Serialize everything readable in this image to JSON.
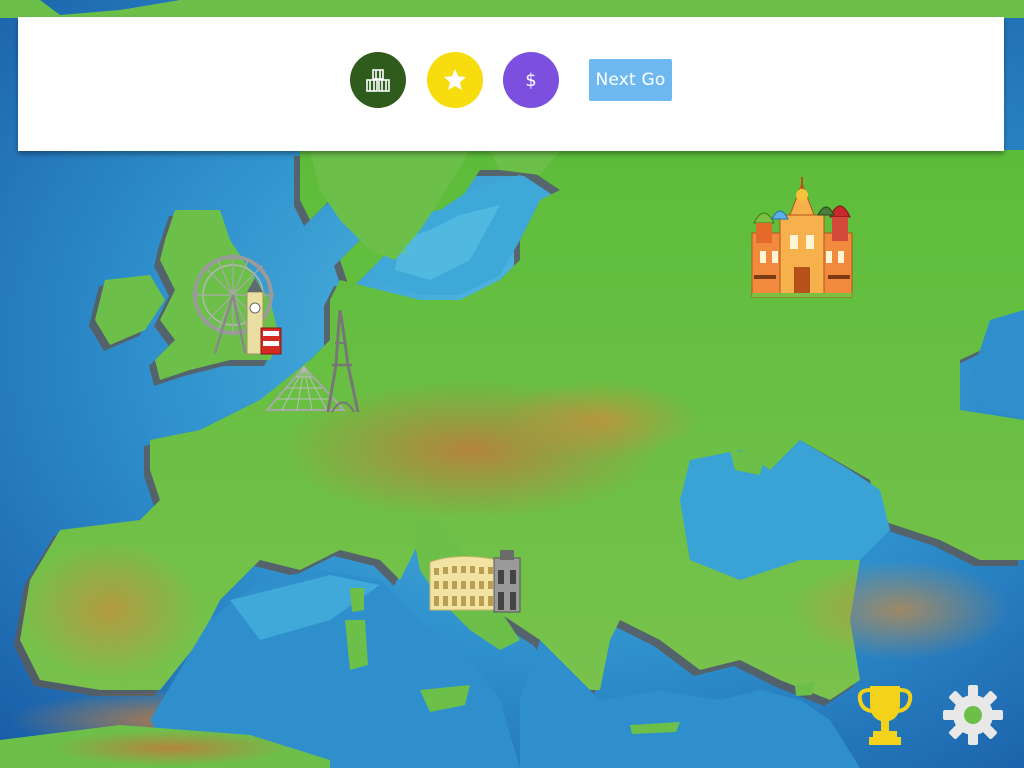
{
  "toolbar": {
    "buildings_icon": "buildings-icon",
    "star_icon": "star-icon",
    "money_label": "$",
    "next_label": "Next Go"
  },
  "landmarks": [
    {
      "name": "london",
      "icon": "london-eye-big-ben-icon"
    },
    {
      "name": "paris",
      "icon": "eiffel-tower-louvre-icon"
    },
    {
      "name": "rome",
      "icon": "colosseum-icon"
    },
    {
      "name": "moscow",
      "icon": "st-basils-cathedral-icon"
    }
  ],
  "footer": {
    "trophy_icon": "trophy-icon",
    "settings_icon": "gear-icon"
  },
  "colors": {
    "sea_deep": "#1e6fb0",
    "sea_light": "#4fb4df",
    "land": "#6cc04a",
    "land_brown": "#b8843e",
    "buildings_button": "#2f5b1c",
    "star_button": "#f7dd0e",
    "money_button": "#7c4fdf",
    "next_button": "#6eb8f2",
    "trophy": "#f2d21a",
    "gear": "#e6e6e6"
  }
}
